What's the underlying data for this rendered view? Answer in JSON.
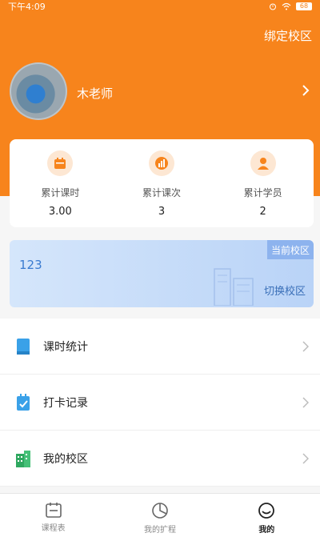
{
  "status_bar": {
    "time": "下午4:09",
    "battery": "68"
  },
  "header": {
    "bind_campus_label": "绑定校区",
    "teacher_name": "木老师"
  },
  "stats": [
    {
      "label": "累计课时",
      "value": "3.00",
      "icon": "calendar-icon"
    },
    {
      "label": "累计课次",
      "value": "3",
      "icon": "bar-chart-icon"
    },
    {
      "label": "累计学员",
      "value": "2",
      "icon": "person-icon"
    }
  ],
  "campus": {
    "name": "123",
    "badge": "当前校区",
    "switch_label": "切换校区"
  },
  "menu": [
    {
      "label": "课时统计",
      "icon": "book-icon"
    },
    {
      "label": "打卡记录",
      "icon": "clipboard-check-icon"
    },
    {
      "label": "我的校区",
      "icon": "building-icon"
    }
  ],
  "tabbar": [
    {
      "label": "课程表",
      "icon": "calendar-icon",
      "active": false
    },
    {
      "label": "我的扩程",
      "icon": "pie-chart-icon",
      "active": false
    },
    {
      "label": "我的",
      "icon": "smiley-icon",
      "active": true
    }
  ],
  "colors": {
    "accent": "#f7841c",
    "campus_blue": "#3a7bd0",
    "card_bg": "#ffffff"
  }
}
